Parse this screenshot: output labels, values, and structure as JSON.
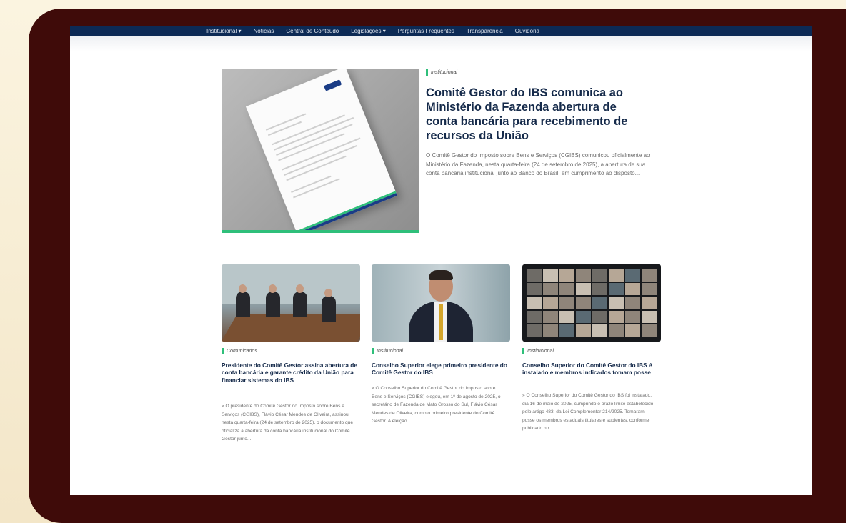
{
  "nav": {
    "items": [
      "Institucional ▾",
      "Notícias",
      "Central de Conteúdo",
      "Legislações ▾",
      "Perguntas Frequentes",
      "Transparência",
      "Ouvidoria"
    ]
  },
  "featured": {
    "tag": "Institucional",
    "title": "Comitê Gestor do IBS comunica ao Ministério da Fazenda abertura de conta bancária para recebimento de recursos da União",
    "description": "O Comitê Gestor do Imposto sobre Bens e Serviços (CGIBS) comunicou oficialmente ao Ministério da Fazenda, nesta quarta-feira (24 de setembro de 2025), a abertura de sua conta bancária institucional junto ao Banco do Brasil, em cumprimento ao disposto..."
  },
  "cards": [
    {
      "tag": "Comunicados",
      "title": "Presidente do Comitê Gestor assina abertura de conta bancária e garante crédito da União para financiar sistemas do IBS",
      "description": "» O presidente do Comitê Gestor do Imposto sobre Bens e Serviços (CGIBS), Flávio César Mendes de Oliveira, assinou, nesta quarta-feira (24 de setembro de 2025), o documento que oficializa a abertura da conta bancária institucional do Comitê Gestor junto..."
    },
    {
      "tag": "Institucional",
      "title": "Conselho Superior elege primeiro presidente do Comitê Gestor do IBS",
      "description": "» O Conselho Superior do Comitê Gestor do Imposto sobre Bens e Serviços (CGIBS) elegeu, em 1º de agosto de 2025, o secretário de Fazenda de Mato Grosso do Sul, Flávio César Mendes de Oliveira, como o primeiro presidente do Comitê Gestor. A eleição..."
    },
    {
      "tag": "Institucional",
      "title": "Conselho Superior do Comitê Gestor do IBS é instalado e membros indicados tomam posse",
      "description": "» O Conselho Superior do Comitê Gestor do IBS foi instalado, dia 16 de maio de 2025, cumprindo o prazo limite estabelecido pelo artigo 483, da Lei Complementar 214/2025. Tomaram posse os membros estaduais titulares e suplentes, conforme publicado no..."
    }
  ]
}
